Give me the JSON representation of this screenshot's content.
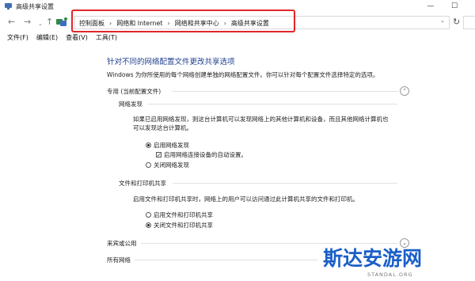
{
  "window": {
    "title": "高级共享设置",
    "minimize": "—",
    "maximize": "☐"
  },
  "nav": {
    "back": "←",
    "forward": "→",
    "recent": "⌄",
    "up": "↑",
    "breadcrumb": [
      "控制面板",
      "网络和 Internet",
      "网络和共享中心",
      "高级共享设置"
    ],
    "separator": "›",
    "dropdown": "⌄",
    "refresh": "↻"
  },
  "menu": [
    "文件(F)",
    "编辑(E)",
    "查看(V)",
    "工具(T)"
  ],
  "content": {
    "title": "针对不同的网络配置文件更改共享选项",
    "intro": "Windows 为你所使用的每个网络创建单独的网络配置文件。你可以针对每个配置文件选择特定的选项。",
    "private_profile": {
      "label": "专用 (当前配置文件)",
      "collapse": "⌃",
      "network_discovery": {
        "heading": "网络发现",
        "description_1": "如果已启用网络发现，则这台计算机可以发现网络上的其他计算机和设备，而且其他网络计算机也",
        "description_2": "可以发现这台计算机。",
        "option_on": "启用网络发现",
        "auto_setup": "启用网络连接设备的自动设置。",
        "auto_setup_check": "✓",
        "option_off": "关闭网络发现"
      },
      "file_printer_sharing": {
        "heading": "文件和打印机共享",
        "description": "启用文件和打印机共享时，网络上的用户可以访问通过此计算机共享的文件和打印机。",
        "option_on": "启用文件和打印机共享",
        "option_off": "关闭文件和打印机共享"
      }
    },
    "guest_public": {
      "label": "来宾或公用",
      "expand": "⌄"
    },
    "all_networks": {
      "label": "所有网络",
      "expand": "⌄"
    }
  },
  "brand": {
    "name": "斯达安游网",
    "url": "STANDAL.ORG"
  }
}
